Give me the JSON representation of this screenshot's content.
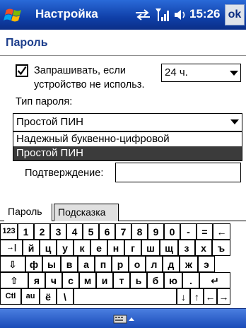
{
  "titlebar": {
    "title": "Настройка",
    "time": "15:26",
    "ok_label": "ok",
    "icons": [
      "windows-flag-icon",
      "sync-icon",
      "signal-icon",
      "volume-icon"
    ]
  },
  "page": {
    "heading": "Пароль",
    "checkbox_label": "Запрашивать, если устройство не использ.",
    "checkbox_checked": true,
    "hours_value": "24 ч.",
    "type_label": "Тип пароля:",
    "type_value": "Простой ПИН",
    "type_options": [
      "Надежный буквенно-цифровой",
      "Простой ПИН"
    ],
    "type_selected_index": 1,
    "confirm_label": "Подтверждение:",
    "confirm_value": ""
  },
  "tabs": [
    "Пароль",
    "Подсказка"
  ],
  "keyboard": {
    "rows": [
      [
        "123",
        "1",
        "2",
        "3",
        "4",
        "5",
        "6",
        "7",
        "8",
        "9",
        "0",
        "-",
        "=",
        "←"
      ],
      [
        "→|",
        "й",
        "ц",
        "у",
        "к",
        "е",
        "н",
        "г",
        "ш",
        "щ",
        "з",
        "х",
        "ъ"
      ],
      [
        "⇩",
        "ф",
        "ы",
        "в",
        "а",
        "п",
        "р",
        "о",
        "л",
        "д",
        "ж",
        "э"
      ],
      [
        "⇧",
        "я",
        "ч",
        "с",
        "м",
        "и",
        "т",
        "ь",
        "б",
        "ю",
        ".",
        "↵"
      ],
      [
        "Ctl",
        "au",
        "ё",
        "\\",
        " ",
        "↓",
        "↑",
        "←",
        "→"
      ]
    ]
  },
  "colors": {
    "titlebar": "#1a4fc0",
    "heading": "#1d3e8c",
    "selection": "#3b3b3b"
  }
}
